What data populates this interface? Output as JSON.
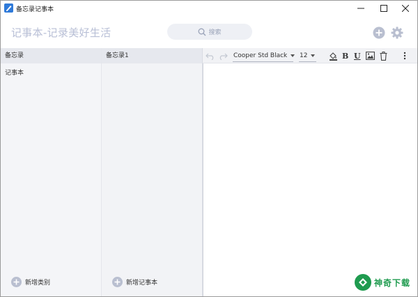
{
  "window": {
    "title": "备忘录记事本"
  },
  "header": {
    "brand": "记事本-记录美好生活",
    "search_placeholder": "搜索"
  },
  "categories": {
    "header": "备忘录",
    "items": [
      "记事本"
    ],
    "add_label": "新增类别"
  },
  "notes": {
    "header": "备忘录1",
    "add_label": "新增记事本"
  },
  "toolbar": {
    "font_family": "Cooper Std Black",
    "font_size": "12",
    "bold_label": "B",
    "underline_label": "U"
  },
  "watermark": {
    "text": "神奇下载"
  },
  "colors": {
    "accent": "#b9bfd0",
    "brand_text": "#b8bfd6",
    "watermark_green": "#1f9b4f",
    "app_icon_blue": "#2f7ad9"
  },
  "icons": [
    "app-icon",
    "minimize-icon",
    "maximize-icon",
    "close-icon",
    "search-icon",
    "add-icon",
    "gear-icon",
    "undo-icon",
    "redo-icon",
    "fill-color-icon",
    "image-icon",
    "trash-icon",
    "more-icon",
    "plus-icon"
  ]
}
